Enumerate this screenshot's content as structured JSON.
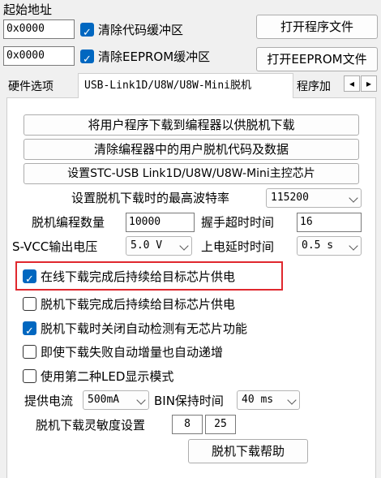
{
  "start_address": {
    "label": "起始地址",
    "code_address": "0x0000",
    "clear_code_label": "清除代码缓冲区",
    "clear_code_checked": true,
    "eeprom_address": "0x0000",
    "clear_eeprom_label": "清除EEPROM缓冲区",
    "clear_eeprom_checked": true
  },
  "top_buttons": {
    "open_program": "打开程序文件",
    "open_eeprom": "打开EEPROM文件"
  },
  "tabs": [
    {
      "label": "硬件选项",
      "active": false
    },
    {
      "label": "USB-Link1D/U8W/U8W-Mini脱机",
      "active": true
    },
    {
      "label": "程序加",
      "active": false
    }
  ],
  "tab_scroll": {
    "left": "◂",
    "right": "▸"
  },
  "panel": {
    "btn_download_user_program": "将用户程序下载到编程器以供脱机下载",
    "btn_clear_offline": "清除编程器中的用户脱机代码及数据",
    "btn_set_master_chip": "设置STC-USB Link1D/U8W/U8W-Mini主控芯片",
    "max_baud_label": "设置脱机下载时的最高波特率",
    "max_baud_value": "115200",
    "prog_count_label": "脱机编程数量",
    "prog_count_value": "10000",
    "handshake_label": "握手超时时间",
    "handshake_value": "16",
    "svcc_label": "S-VCC输出电压",
    "svcc_value": "5.0 V",
    "power_delay_label": "上电延时时间",
    "power_delay_value": "0.5 s",
    "checkboxes": [
      {
        "label": "在线下载完成后持续给目标芯片供电",
        "checked": true,
        "highlighted": true
      },
      {
        "label": "脱机下载完成后持续给目标芯片供电",
        "checked": false
      },
      {
        "label": "脱机下载时关闭自动检测有无芯片功能",
        "checked": true
      },
      {
        "label": "即使下载失败自动增量也自动递增",
        "checked": false
      },
      {
        "label": "使用第二种LED显示模式",
        "checked": false
      }
    ],
    "supply_current_label": "提供电流",
    "supply_current_value": "500mA",
    "bin_hold_label": "BIN保持时间",
    "bin_hold_value": "40 ms",
    "sensitivity_label": "脱机下载灵敏度设置",
    "sensitivity_value1": "8",
    "sensitivity_value2": "25",
    "help_button": "脱机下载帮助"
  },
  "colors": {
    "highlight_border": "#e0282e",
    "checkbox_accent": "#0067c0"
  }
}
